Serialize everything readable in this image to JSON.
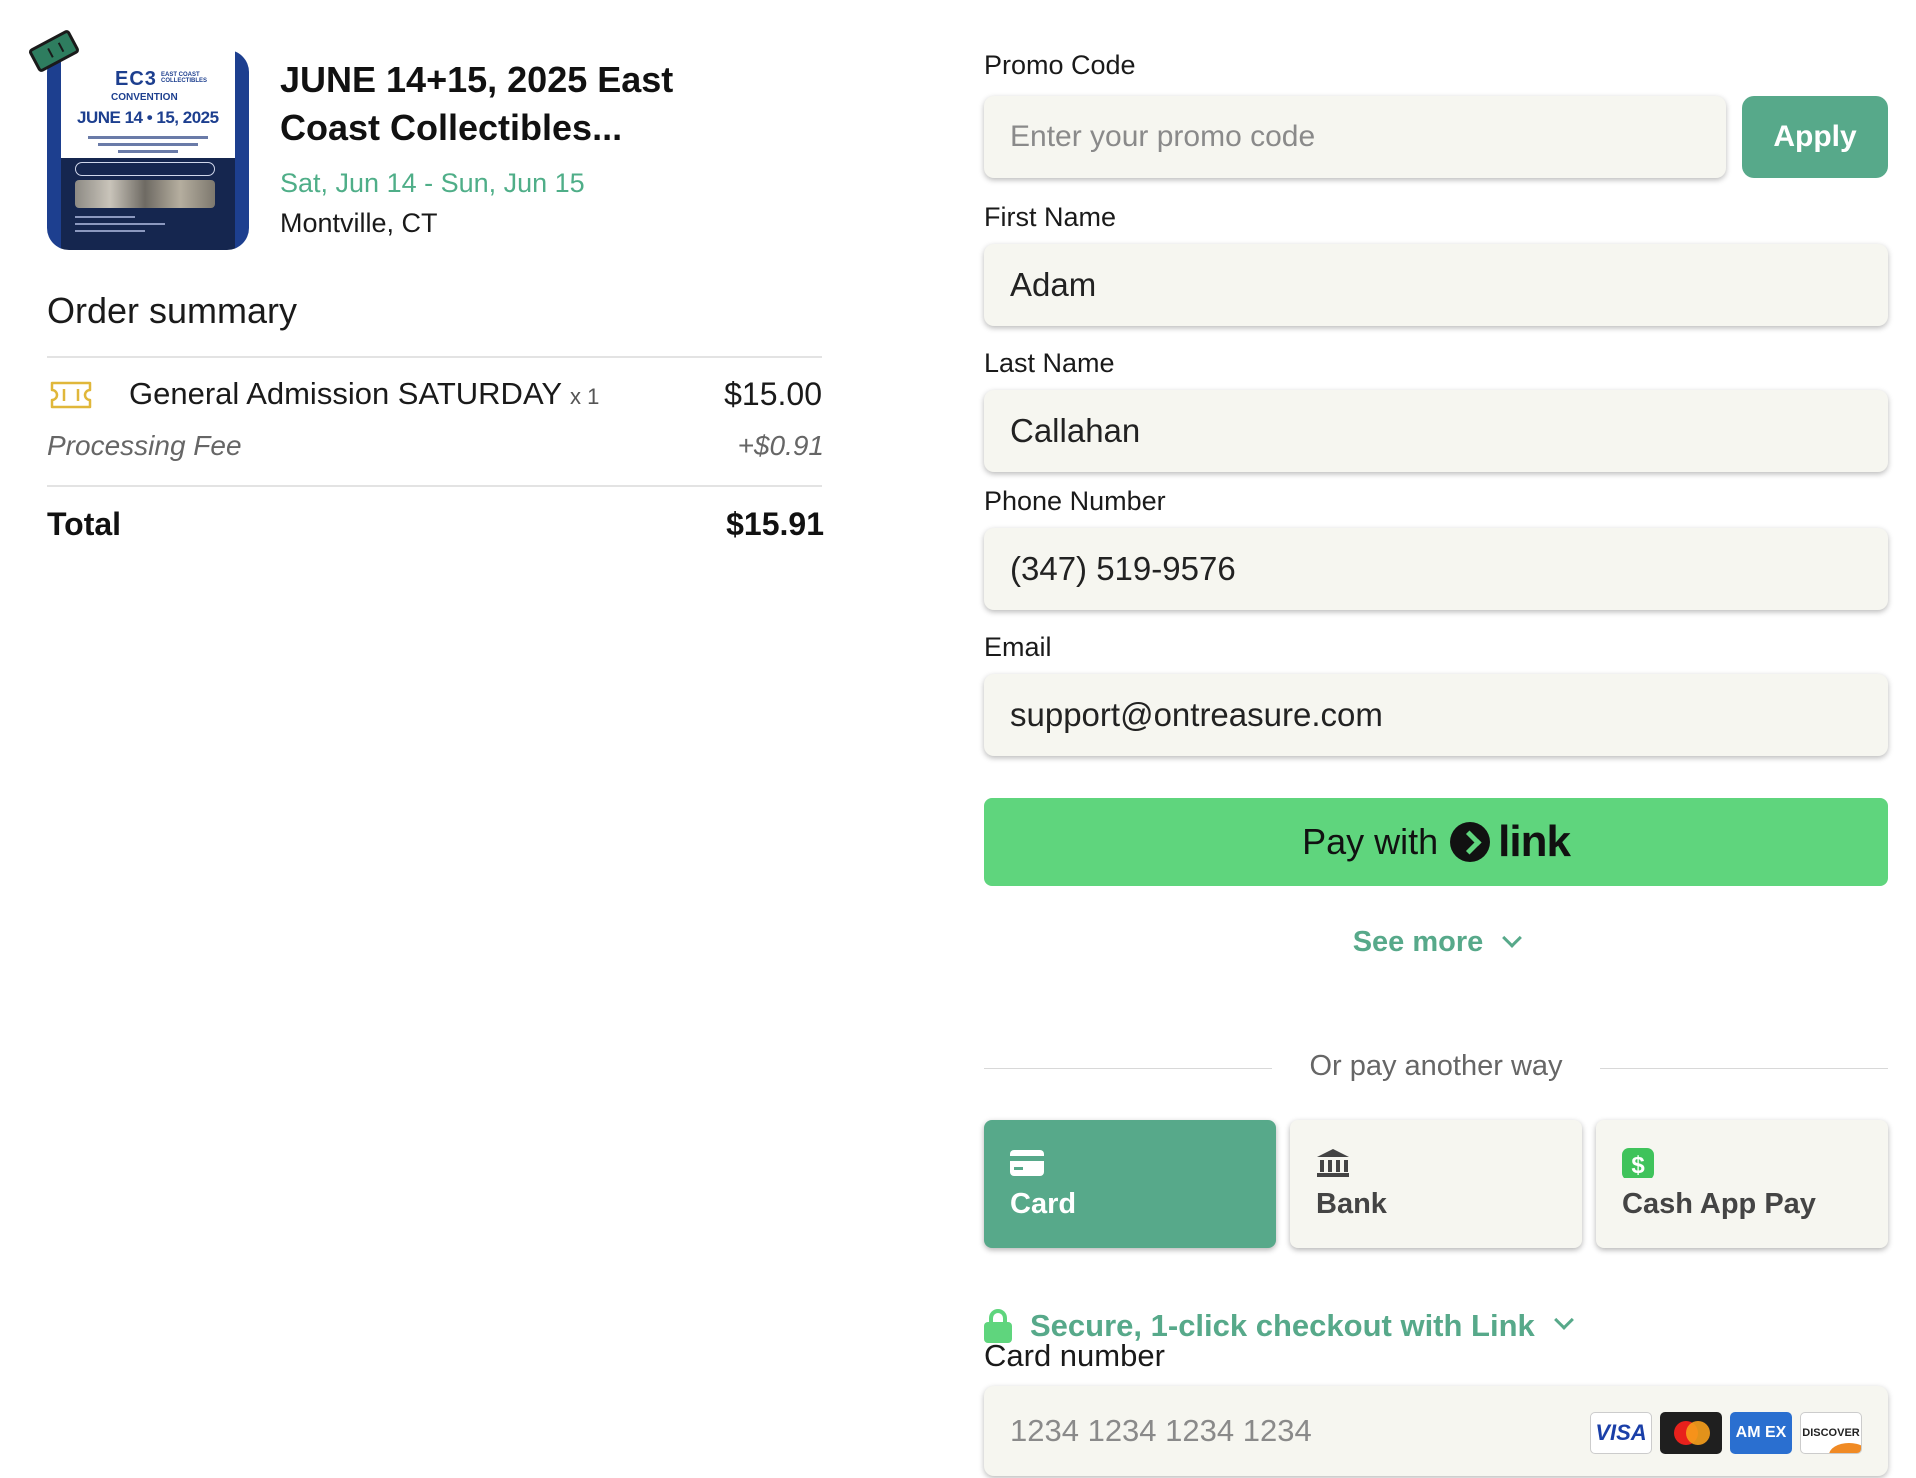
{
  "event": {
    "poster": {
      "logo": "EC3",
      "logo_sub": "EAST COAST COLLECTIBLES",
      "convention": "CONVENTION",
      "date_banner": "JUNE 14 • 15, 2025"
    },
    "title": "JUNE 14+15, 2025 East Coast Collectibles...",
    "dates": "Sat, Jun 14 - Sun, Jun 15",
    "location": "Montville, CT"
  },
  "order": {
    "title": "Order summary",
    "items": [
      {
        "name": "General Admission SATURDAY",
        "qty": "x 1",
        "price": "$15.00",
        "icon": "ticket-icon"
      }
    ],
    "fee": {
      "label": "Processing Fee",
      "amount": "+$0.91"
    },
    "total": {
      "label": "Total",
      "amount": "$15.91"
    }
  },
  "form": {
    "promo": {
      "label": "Promo Code",
      "placeholder": "Enter your promo code",
      "apply_label": "Apply"
    },
    "first_name": {
      "label": "First Name",
      "value": "Adam"
    },
    "last_name": {
      "label": "Last Name",
      "value": "Callahan"
    },
    "phone": {
      "label": "Phone Number",
      "value": "(347) 519-9576"
    },
    "email": {
      "label": "Email",
      "value": "support@ontreasure.com"
    }
  },
  "payment": {
    "link_button": {
      "prefix": "Pay with",
      "brand": "link"
    },
    "see_more": "See more",
    "or_text": "Or pay another way",
    "methods": [
      {
        "label": "Card",
        "icon": "card-icon",
        "selected": true
      },
      {
        "label": "Bank",
        "icon": "bank-icon",
        "selected": false
      },
      {
        "label": "Cash App Pay",
        "icon": "cash-app-icon",
        "selected": false
      }
    ],
    "secure_text": "Secure, 1-click checkout with Link",
    "card_number": {
      "label": "Card number",
      "placeholder": "1234 1234 1234 1234"
    },
    "brands": {
      "visa": "VISA",
      "amex": "AM EX",
      "discover": "DISCOVER"
    }
  },
  "colors": {
    "accent": "#57a98a",
    "link_green": "#5fd57d",
    "field_bg": "#f6f6f0"
  }
}
